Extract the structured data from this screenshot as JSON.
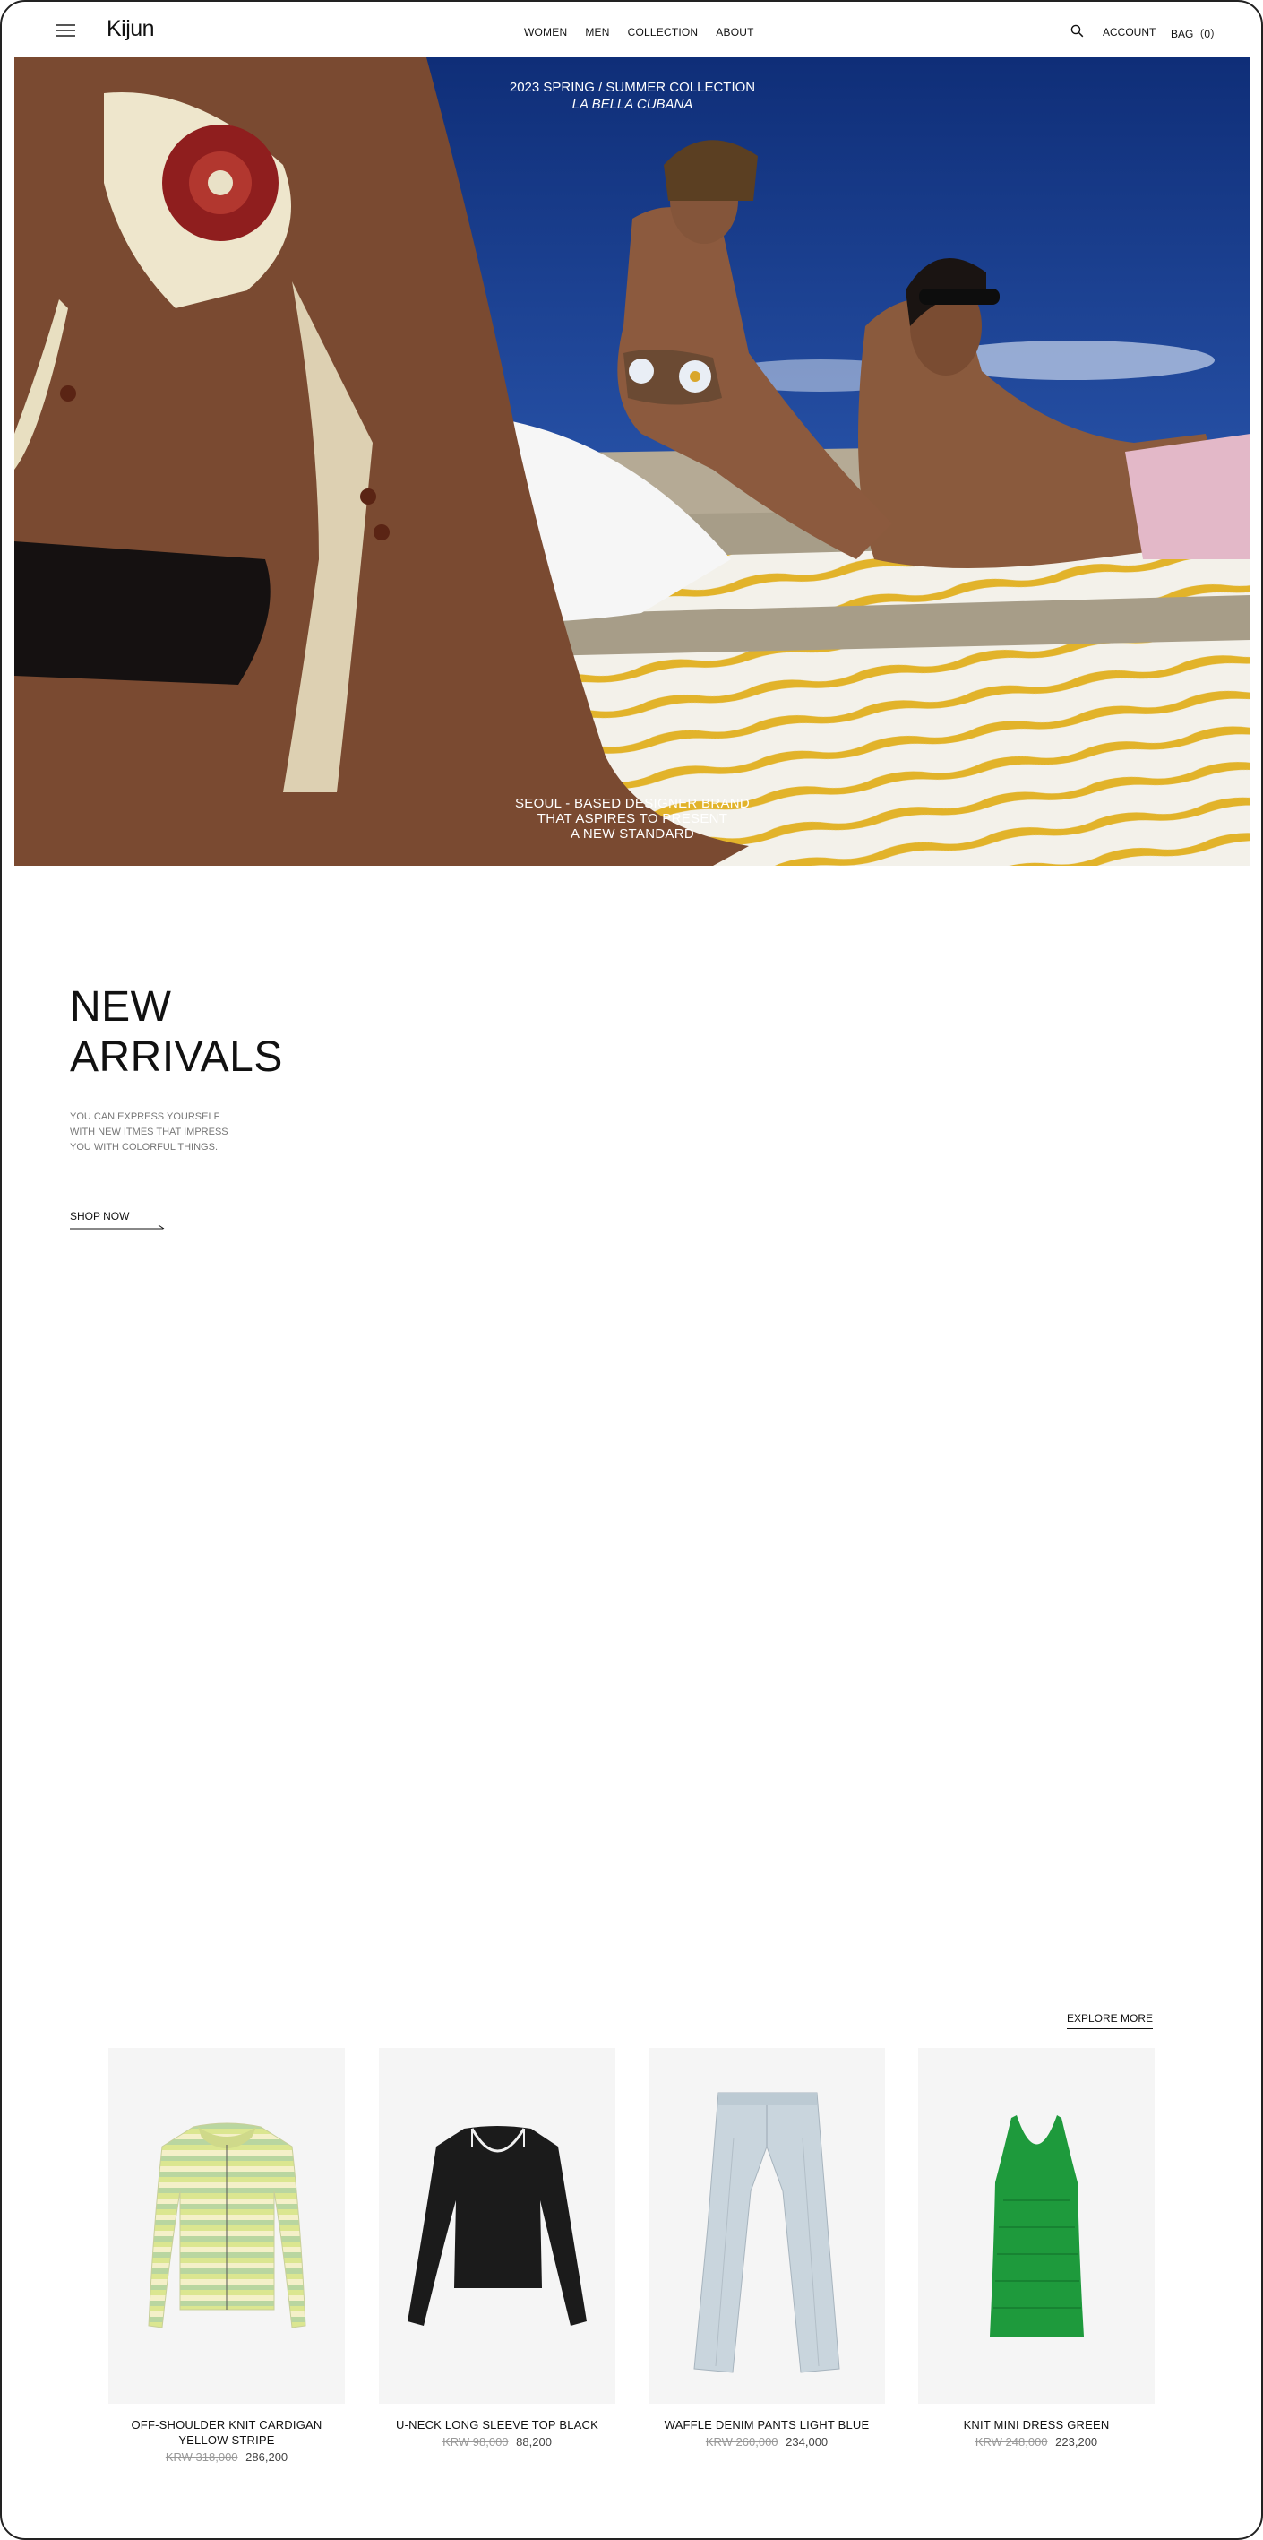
{
  "header": {
    "logo": "Kijun",
    "nav": [
      "WOMEN",
      "MEN",
      "COLLECTION",
      "ABOUT"
    ],
    "account_label": "ACCOUNT",
    "bag_label": "BAG（0）"
  },
  "hero": {
    "collection_line": "2023 SPRING / SUMMER COLLECTION",
    "collection_name": "LA BELLA CUBANA",
    "tagline": [
      "SEOUL - BASED DESIGNER BRAND",
      "THAT ASPIRES TO PRESENT",
      "A NEW STANDARD"
    ]
  },
  "new_arrivals": {
    "title_line1": "NEW",
    "title_line2": "ARRIVALS",
    "description": [
      "YOU CAN EXPRESS YOURSELF",
      "WITH NEW ITMES THAT IMPRESS",
      "YOU WITH COLORFUL THINGS."
    ],
    "cta": "SHOP NOW",
    "explore": "EXPLORE MORE"
  },
  "products": [
    {
      "name_line1": "OFF-SHOULDER KNIT CARDIGAN",
      "name_line2": "YELLOW STRIPE",
      "old_price": "KRW 318,000",
      "price": "286,200",
      "image": "striped-cardigan"
    },
    {
      "name_line1": "U-NECK LONG SLEEVE TOP BLACK",
      "name_line2": "",
      "old_price": "KRW 98,000",
      "price": "88,200",
      "image": "black-longsleeve"
    },
    {
      "name_line1": "WAFFLE DENIM PANTS LIGHT BLUE",
      "name_line2": "",
      "old_price": "KRW 260,000",
      "price": "234,000",
      "image": "denim-pants"
    },
    {
      "name_line1": "KNIT MINI DRESS GREEN",
      "name_line2": "",
      "old_price": "KRW 248,000",
      "price": "223,200",
      "image": "green-dress"
    }
  ],
  "colors": {
    "sky": "#1b3f8f",
    "sand": "#b5aa95",
    "towel_yellow": "#e2b32a",
    "dress_green": "#1e9a3c"
  }
}
